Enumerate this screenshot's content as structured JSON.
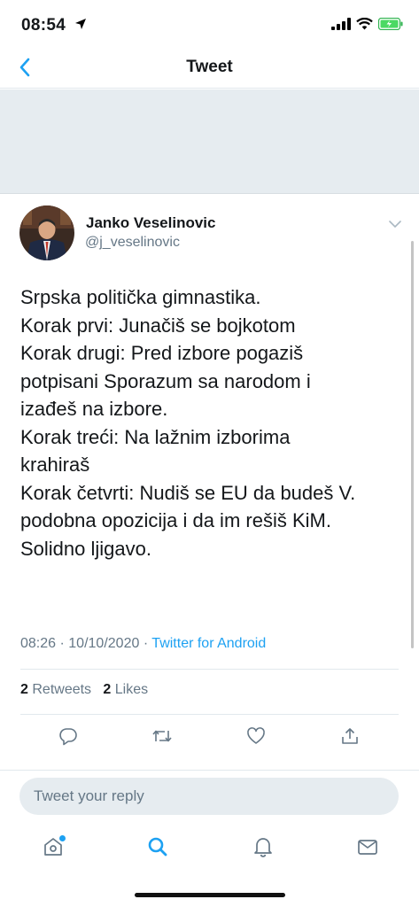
{
  "status_bar": {
    "time": "08:54"
  },
  "nav": {
    "title": "Tweet"
  },
  "tweet": {
    "author_name": "Janko Veselinovic",
    "author_handle": "@j_veselinovic",
    "text_lines": [
      "Srpska politička gimnastika.",
      "Korak prvi: Junačiš se bojkotom",
      "Korak drugi: Pred izbore pogaziš",
      "potpisani Sporazum sa narodom i",
      "izađeš na izbore.",
      "Korak treći: Na lažnim izborima",
      "krahiraš",
      "Korak četvrti: Nudiš se EU da budeš V.",
      "podobna opozicija i da im rešiš KiM.",
      "Solidno ljigavo."
    ],
    "time": "08:26",
    "date": "10/10/2020",
    "source": "Twitter for Android",
    "retweets_count": "2",
    "retweets_label": "Retweets",
    "likes_count": "2",
    "likes_label": "Likes"
  },
  "reply": {
    "placeholder": "Tweet your reply"
  },
  "icons": {
    "back": "chevron-left-icon",
    "caret": "chevron-down-icon",
    "reply": "comment-icon",
    "retweet": "retweet-icon",
    "like": "heart-icon",
    "share": "share-icon",
    "home": "home-icon",
    "search": "search-icon",
    "notifications": "bell-icon",
    "messages": "mail-icon"
  },
  "colors": {
    "accent": "#1da1f2",
    "secondary_text": "#657786",
    "divider": "#e1e8ed"
  }
}
